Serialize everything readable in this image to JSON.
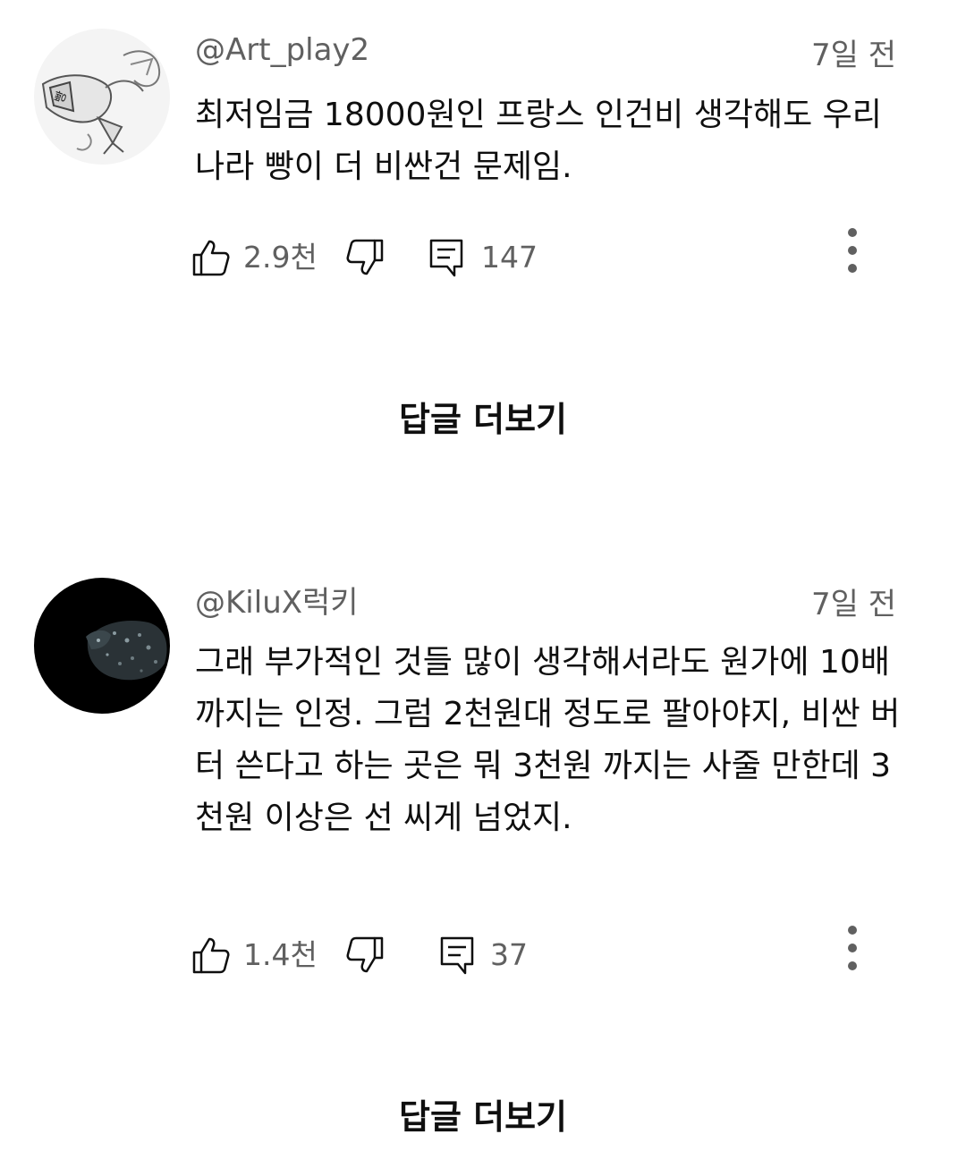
{
  "comments": [
    {
      "handle": "@Art_play2",
      "time": "7일 전",
      "text": "최저임금 18000원인 프랑스 인건비 생각해도 우리나라 빵이 더 비싼건 문제임.",
      "likes": "2.9천",
      "replies": "147",
      "avatar_icon": "sketch-bird-avatar",
      "more_replies": "답글 더보기"
    },
    {
      "handle": "@KiluX럭키",
      "time": "7일 전",
      "text": "그래 부가적인 것들 많이 생각해서라도 원가에 10배 까지는 인정. 그럼 2천원대 정도로 팔아야지, 비싼 버터 쓴다고 하는 곳은 뭐 3천원 까지는 사줄 만한데 3천원 이상은 선 씨게 넘었지.",
      "likes": "1.4천",
      "replies": "37",
      "avatar_icon": "leopard-dark-avatar",
      "more_replies": "답글 더보기"
    }
  ],
  "colors": {
    "primary_text": "#0f0f0f",
    "secondary_text": "#606060",
    "background": "#ffffff"
  }
}
